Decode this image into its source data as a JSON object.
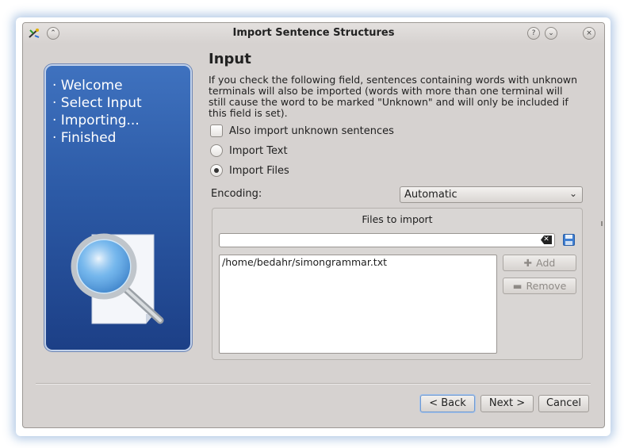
{
  "window": {
    "title": "Import Sentence Structures",
    "help_btn": "?",
    "shade_btn": "⌄",
    "close_btn": "×",
    "keepabove_btn": "⌃"
  },
  "sidebar": {
    "steps": [
      "· Welcome",
      "· Select Input",
      "· Importing...",
      "· Finished"
    ]
  },
  "page": {
    "heading": "Input",
    "description": "If you check the following field, sentences containing words with unknown terminals will also be imported (words with more than one terminal will still cause the word to be marked \"Unknown\" and will only be included if this field is set).",
    "options": {
      "unknown_label": "Also import unknown sentences",
      "import_text_label": "Import Text",
      "import_files_label": "Import Files"
    },
    "encoding": {
      "label": "Encoding:",
      "value": "Automatic"
    },
    "files": {
      "group_title": "Files to import",
      "input_value": "",
      "list": [
        "/home/bedahr/simongrammar.txt"
      ],
      "add_label": "Add",
      "remove_label": "Remove"
    }
  },
  "footer": {
    "back_label": "< Back",
    "next_label": "Next >",
    "cancel_label": "Cancel"
  },
  "colors": {
    "panel": "#2c5aa6",
    "window_bg": "#d6d2d0",
    "focus": "#6f9ad2"
  }
}
